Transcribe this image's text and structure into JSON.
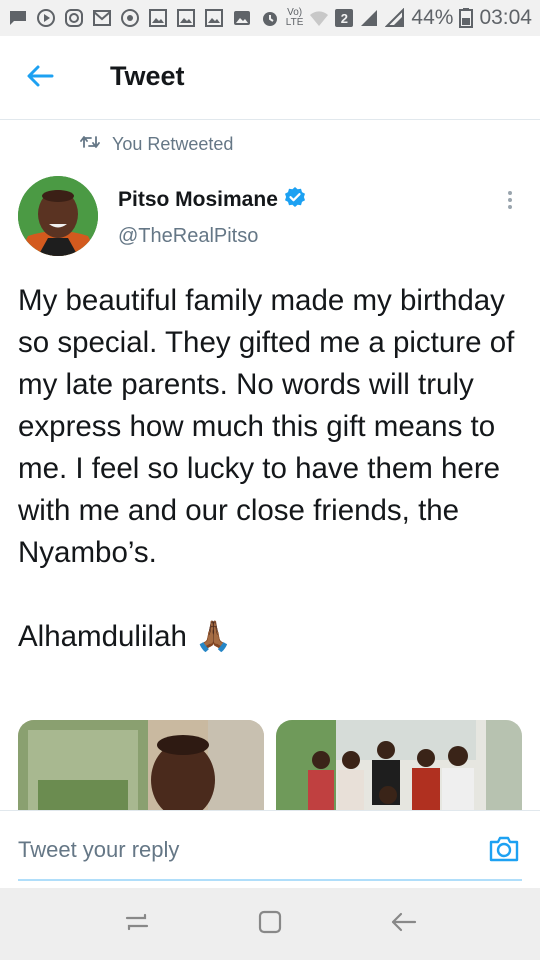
{
  "status_bar": {
    "battery": "44%",
    "time": "03:04",
    "volte_top": "Vo)",
    "volte_bottom": "LTE",
    "sim_slot": "2",
    "icons": [
      "message-icon",
      "play-icon",
      "instagram-icon",
      "gmail-icon",
      "chrome-icon",
      "gallery-icon",
      "gallery-icon",
      "gallery-icon",
      "photo-icon",
      "alarm-icon",
      "wifi-icon",
      "signal-icon",
      "battery-icon"
    ]
  },
  "header": {
    "title": "Tweet",
    "back_icon": "back-arrow-icon"
  },
  "tweet": {
    "retweet_label": "You Retweeted",
    "author_name": "Pitso Mosimane",
    "author_handle": "@TheRealPitso",
    "text": "My beautiful family made my birthday so special. They gifted me a picture of my late parents. No words will truly express how much this gift means to me. I feel so lucky to have them here with me and our close friends, the Nyambo’s.\n\nAlhamdulilah 🙏🏾",
    "photos": [
      "photo-1",
      "photo-2"
    ]
  },
  "reply": {
    "placeholder": "Tweet your reply",
    "camera_icon": "camera-icon"
  },
  "nav": {
    "icons": [
      "recents-icon",
      "home-icon",
      "back-icon"
    ]
  },
  "colors": {
    "accent": "#1da1f2",
    "text": "#14171a",
    "secondary": "#657786"
  }
}
